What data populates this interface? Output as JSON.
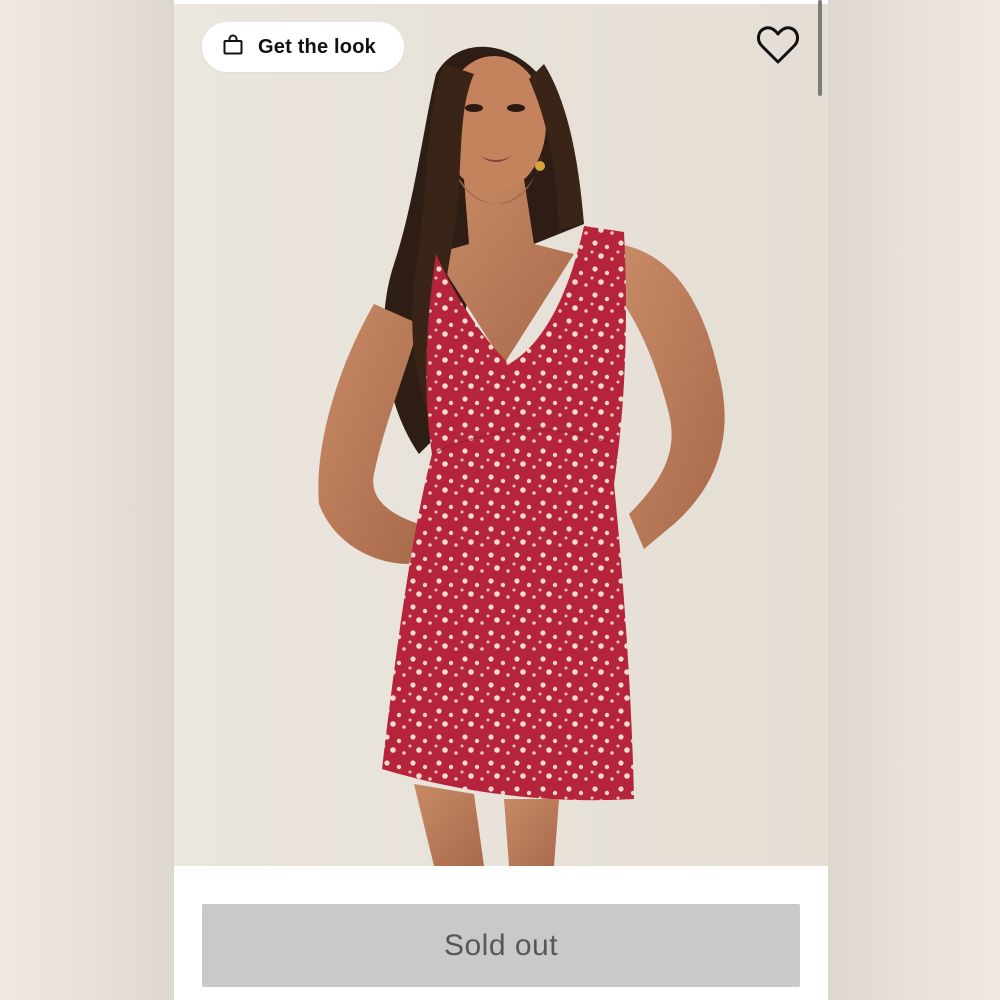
{
  "product_card": {
    "get_the_look_label": "Get the look",
    "bag_icon": "shopping-bag-icon",
    "favorite_icon": "heart-outline-icon",
    "sold_out_label": "Sold out",
    "image_alt": "Model wearing red floral mini dress"
  },
  "colors": {
    "dress": "#b5243a",
    "button_bg": "#c9c9c9",
    "button_text": "#575757"
  }
}
